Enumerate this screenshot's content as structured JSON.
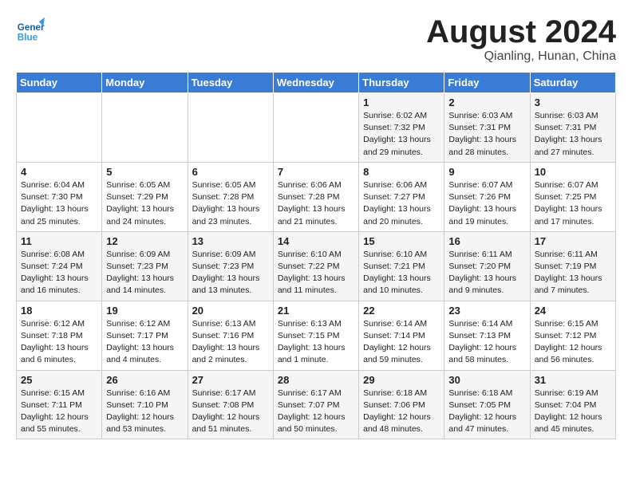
{
  "logo": {
    "line1": "General",
    "line2": "Blue"
  },
  "title": "August 2024",
  "subtitle": "Qianling, Hunan, China",
  "weekdays": [
    "Sunday",
    "Monday",
    "Tuesday",
    "Wednesday",
    "Thursday",
    "Friday",
    "Saturday"
  ],
  "weeks": [
    [
      {
        "day": "",
        "info": ""
      },
      {
        "day": "",
        "info": ""
      },
      {
        "day": "",
        "info": ""
      },
      {
        "day": "",
        "info": ""
      },
      {
        "day": "1",
        "info": "Sunrise: 6:02 AM\nSunset: 7:32 PM\nDaylight: 13 hours\nand 29 minutes."
      },
      {
        "day": "2",
        "info": "Sunrise: 6:03 AM\nSunset: 7:31 PM\nDaylight: 13 hours\nand 28 minutes."
      },
      {
        "day": "3",
        "info": "Sunrise: 6:03 AM\nSunset: 7:31 PM\nDaylight: 13 hours\nand 27 minutes."
      }
    ],
    [
      {
        "day": "4",
        "info": "Sunrise: 6:04 AM\nSunset: 7:30 PM\nDaylight: 13 hours\nand 25 minutes."
      },
      {
        "day": "5",
        "info": "Sunrise: 6:05 AM\nSunset: 7:29 PM\nDaylight: 13 hours\nand 24 minutes."
      },
      {
        "day": "6",
        "info": "Sunrise: 6:05 AM\nSunset: 7:28 PM\nDaylight: 13 hours\nand 23 minutes."
      },
      {
        "day": "7",
        "info": "Sunrise: 6:06 AM\nSunset: 7:28 PM\nDaylight: 13 hours\nand 21 minutes."
      },
      {
        "day": "8",
        "info": "Sunrise: 6:06 AM\nSunset: 7:27 PM\nDaylight: 13 hours\nand 20 minutes."
      },
      {
        "day": "9",
        "info": "Sunrise: 6:07 AM\nSunset: 7:26 PM\nDaylight: 13 hours\nand 19 minutes."
      },
      {
        "day": "10",
        "info": "Sunrise: 6:07 AM\nSunset: 7:25 PM\nDaylight: 13 hours\nand 17 minutes."
      }
    ],
    [
      {
        "day": "11",
        "info": "Sunrise: 6:08 AM\nSunset: 7:24 PM\nDaylight: 13 hours\nand 16 minutes."
      },
      {
        "day": "12",
        "info": "Sunrise: 6:09 AM\nSunset: 7:23 PM\nDaylight: 13 hours\nand 14 minutes."
      },
      {
        "day": "13",
        "info": "Sunrise: 6:09 AM\nSunset: 7:23 PM\nDaylight: 13 hours\nand 13 minutes."
      },
      {
        "day": "14",
        "info": "Sunrise: 6:10 AM\nSunset: 7:22 PM\nDaylight: 13 hours\nand 11 minutes."
      },
      {
        "day": "15",
        "info": "Sunrise: 6:10 AM\nSunset: 7:21 PM\nDaylight: 13 hours\nand 10 minutes."
      },
      {
        "day": "16",
        "info": "Sunrise: 6:11 AM\nSunset: 7:20 PM\nDaylight: 13 hours\nand 9 minutes."
      },
      {
        "day": "17",
        "info": "Sunrise: 6:11 AM\nSunset: 7:19 PM\nDaylight: 13 hours\nand 7 minutes."
      }
    ],
    [
      {
        "day": "18",
        "info": "Sunrise: 6:12 AM\nSunset: 7:18 PM\nDaylight: 13 hours\nand 6 minutes."
      },
      {
        "day": "19",
        "info": "Sunrise: 6:12 AM\nSunset: 7:17 PM\nDaylight: 13 hours\nand 4 minutes."
      },
      {
        "day": "20",
        "info": "Sunrise: 6:13 AM\nSunset: 7:16 PM\nDaylight: 13 hours\nand 2 minutes."
      },
      {
        "day": "21",
        "info": "Sunrise: 6:13 AM\nSunset: 7:15 PM\nDaylight: 13 hours\nand 1 minute."
      },
      {
        "day": "22",
        "info": "Sunrise: 6:14 AM\nSunset: 7:14 PM\nDaylight: 12 hours\nand 59 minutes."
      },
      {
        "day": "23",
        "info": "Sunrise: 6:14 AM\nSunset: 7:13 PM\nDaylight: 12 hours\nand 58 minutes."
      },
      {
        "day": "24",
        "info": "Sunrise: 6:15 AM\nSunset: 7:12 PM\nDaylight: 12 hours\nand 56 minutes."
      }
    ],
    [
      {
        "day": "25",
        "info": "Sunrise: 6:15 AM\nSunset: 7:11 PM\nDaylight: 12 hours\nand 55 minutes."
      },
      {
        "day": "26",
        "info": "Sunrise: 6:16 AM\nSunset: 7:10 PM\nDaylight: 12 hours\nand 53 minutes."
      },
      {
        "day": "27",
        "info": "Sunrise: 6:17 AM\nSunset: 7:08 PM\nDaylight: 12 hours\nand 51 minutes."
      },
      {
        "day": "28",
        "info": "Sunrise: 6:17 AM\nSunset: 7:07 PM\nDaylight: 12 hours\nand 50 minutes."
      },
      {
        "day": "29",
        "info": "Sunrise: 6:18 AM\nSunset: 7:06 PM\nDaylight: 12 hours\nand 48 minutes."
      },
      {
        "day": "30",
        "info": "Sunrise: 6:18 AM\nSunset: 7:05 PM\nDaylight: 12 hours\nand 47 minutes."
      },
      {
        "day": "31",
        "info": "Sunrise: 6:19 AM\nSunset: 7:04 PM\nDaylight: 12 hours\nand 45 minutes."
      }
    ]
  ]
}
